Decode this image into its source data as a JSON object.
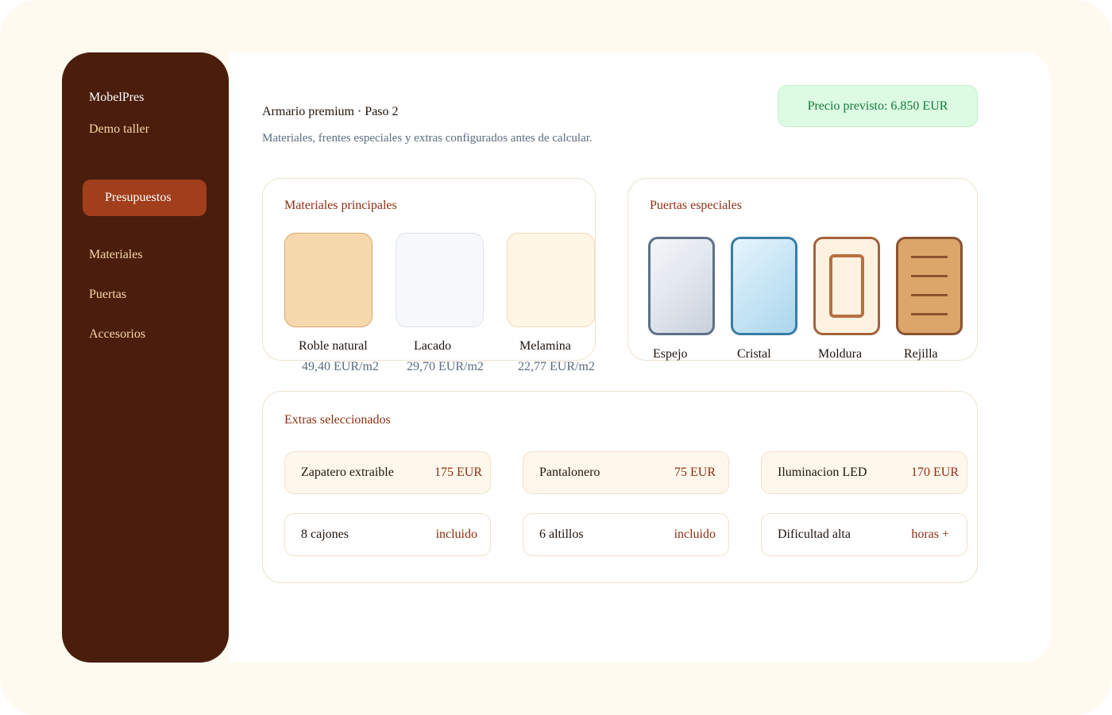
{
  "app": {
    "brand": "MobelPres",
    "workspace": "Demo taller"
  },
  "sidebar": {
    "active_label": "Presupuestos",
    "items": [
      {
        "label": "Materiales"
      },
      {
        "label": "Puertas"
      },
      {
        "label": "Accesorios"
      }
    ]
  },
  "header": {
    "title": "Armario premium · Paso 2",
    "subtitle": "Materiales, frentes especiales y extras configurados antes de calcular.",
    "price_badge": "Precio previsto: 6.850 EUR"
  },
  "materials": {
    "title": "Materiales principales",
    "items": [
      {
        "name": "Roble natural",
        "price": "49,40 EUR/m2",
        "fill": "#f5d9ad",
        "border": "#d9a66a"
      },
      {
        "name": "Lacado",
        "price": "29,70 EUR/m2",
        "fill": "#f6f8fb",
        "border": "#dde3ea"
      },
      {
        "name": "Melamina",
        "price": "22,77 EUR/m2",
        "fill": "#fff6e6",
        "border": "#f0d9b8"
      }
    ]
  },
  "doors": {
    "title": "Puertas especiales",
    "items": [
      {
        "name": "Espejo",
        "icon": "mirror-door-icon"
      },
      {
        "name": "Cristal",
        "icon": "glass-door-icon"
      },
      {
        "name": "Moldura",
        "icon": "molding-door-icon"
      },
      {
        "name": "Rejilla",
        "icon": "grille-door-icon"
      }
    ]
  },
  "extras": {
    "title": "Extras seleccionados",
    "items": [
      {
        "label": "Zapatero extraible",
        "value": "175 EUR"
      },
      {
        "label": "Pantalonero",
        "value": "75 EUR"
      },
      {
        "label": "Iluminacion LED",
        "value": "170 EUR"
      },
      {
        "label": "8 cajones",
        "value": "incluido"
      },
      {
        "label": "6 altillos",
        "value": "incluido"
      },
      {
        "label": "Dificultad alta",
        "value": "horas +"
      }
    ]
  },
  "colors": {
    "sidebar_bg": "#4a1d0c",
    "accent": "#a13e1b",
    "price_badge_bg": "#dcfbe2",
    "price_text": "#137a3b"
  }
}
